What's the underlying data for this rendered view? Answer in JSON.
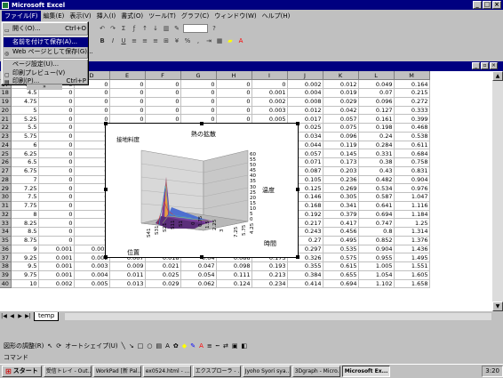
{
  "window": {
    "title": "Microsoft Excel",
    "min": "_",
    "max": "□",
    "close": "×"
  },
  "menu": [
    "ファイル(F)",
    "編集(E)",
    "表示(V)",
    "挿入(I)",
    "書式(O)",
    "ツール(T)",
    "グラフ(C)",
    "ウィンドウ(W)",
    "ヘルプ(H)"
  ],
  "toolbar": {
    "zoom": "",
    "question": "?"
  },
  "file_menu": {
    "open": {
      "label": "開く(O)...",
      "shortcut": "Ctrl+O"
    },
    "save_as": {
      "label": "名前を付けて保存(A)..."
    },
    "web_save": {
      "label": "Web ページとして保存(G)..."
    },
    "page_setup": {
      "label": "ページ設定(U)..."
    },
    "print_preview": {
      "label": "印刷プレビュー(V)"
    },
    "print": {
      "label": "印刷(P)...",
      "shortcut": "Ctrl+P"
    },
    "more": "»"
  },
  "columns": [
    "C",
    "D",
    "E",
    "F",
    "G",
    "H",
    "I",
    "J",
    "K",
    "L",
    "M"
  ],
  "rows": [
    {
      "n": "17",
      "b": "4.25",
      "c": [
        "0",
        "0",
        "0",
        "0",
        "0",
        "0",
        "0",
        "0.002",
        "0.012",
        "0.049",
        "0.164"
      ]
    },
    {
      "n": "18",
      "b": "4.5",
      "c": [
        "0",
        "0",
        "0",
        "0",
        "0",
        "0",
        "0.001",
        "0.004",
        "0.019",
        "0.07",
        "0.215"
      ]
    },
    {
      "n": "19",
      "b": "4.75",
      "c": [
        "0",
        "0",
        "0",
        "0",
        "0",
        "0",
        "0.002",
        "0.008",
        "0.029",
        "0.096",
        "0.272"
      ]
    },
    {
      "n": "20",
      "b": "5",
      "c": [
        "0",
        "0",
        "0",
        "0",
        "0",
        "0",
        "0.003",
        "0.012",
        "0.042",
        "0.127",
        "0.333"
      ]
    },
    {
      "n": "21",
      "b": "5.25",
      "c": [
        "0",
        "0",
        "0",
        "0",
        "0",
        "0",
        "0.005",
        "0.017",
        "0.057",
        "0.161",
        "0.399"
      ]
    },
    {
      "n": "22",
      "b": "5.5",
      "c": [
        "0",
        "0",
        "0",
        "0",
        "0",
        "0",
        "0.007",
        "0.025",
        "0.075",
        "0.198",
        "0.468"
      ]
    },
    {
      "n": "23",
      "b": "5.75",
      "c": [
        "0",
        "0",
        "0",
        "0",
        "0",
        "0",
        "0.01",
        "0.034",
        "0.096",
        "0.24",
        "0.538"
      ]
    },
    {
      "n": "24",
      "b": "6",
      "c": [
        "0",
        "0",
        "0",
        "0",
        "0",
        "0",
        "0.015",
        "0.044",
        "0.119",
        "0.284",
        "0.611"
      ]
    },
    {
      "n": "25",
      "b": "6.25",
      "c": [
        "0",
        "0",
        "0",
        "0",
        "0",
        "0",
        "0.02",
        "0.057",
        "0.145",
        "0.331",
        "0.684"
      ]
    },
    {
      "n": "26",
      "b": "6.5",
      "c": [
        "0",
        "0",
        "0",
        "0",
        "0",
        "0",
        "0.026",
        "0.071",
        "0.173",
        "0.38",
        "0.758"
      ]
    },
    {
      "n": "27",
      "b": "6.75",
      "c": [
        "0",
        "0",
        "0",
        "0",
        "0",
        "0",
        "0.034",
        "0.087",
        "0.203",
        "0.43",
        "0.831"
      ]
    },
    {
      "n": "28",
      "b": "7",
      "c": [
        "0",
        "0",
        "0",
        "0",
        "0",
        "0",
        "0.043",
        "0.105",
        "0.236",
        "0.482",
        "0.904"
      ]
    },
    {
      "n": "29",
      "b": "7.25",
      "c": [
        "0",
        "0",
        "0",
        "0",
        "0",
        "0",
        "0.053",
        "0.125",
        "0.269",
        "0.534",
        "0.976"
      ]
    },
    {
      "n": "30",
      "b": "7.5",
      "c": [
        "0",
        "0",
        "0",
        "0",
        "0",
        "0",
        "0.064",
        "0.146",
        "0.305",
        "0.587",
        "1.047"
      ]
    },
    {
      "n": "31",
      "b": "7.75",
      "c": [
        "0",
        "0",
        "0",
        "0",
        "0",
        "0",
        "0.076",
        "0.168",
        "0.341",
        "0.641",
        "1.116"
      ]
    },
    {
      "n": "32",
      "b": "8",
      "c": [
        "0",
        "0",
        "0",
        "0",
        "0",
        "0",
        "0.09",
        "0.192",
        "0.379",
        "0.694",
        "1.184"
      ]
    },
    {
      "n": "33",
      "b": "8.25",
      "c": [
        "0",
        "0",
        "0",
        "0",
        "0",
        "0",
        "0.105",
        "0.217",
        "0.417",
        "0.747",
        "1.25"
      ]
    },
    {
      "n": "34",
      "b": "8.5",
      "c": [
        "0",
        "0",
        "0",
        "0",
        "0",
        "0",
        "0.12",
        "0.243",
        "0.456",
        "0.8",
        "1.314"
      ]
    },
    {
      "n": "35",
      "b": "8.75",
      "c": [
        "0",
        "0",
        "0",
        "0",
        "0",
        "0",
        "0.137",
        "0.27",
        "0.495",
        "0.852",
        "1.376"
      ]
    },
    {
      "n": "36",
      "b": "9",
      "c": [
        "0",
        "0.001",
        "0.002",
        "0.006",
        "0.014",
        "0.034",
        "0.075",
        "0.155",
        "0.297",
        "0.535",
        "0.904",
        "1.436"
      ]
    },
    {
      "n": "37",
      "b": "9.25",
      "c": [
        "0",
        "0.001",
        "0.002",
        "0.007",
        "0.018",
        "0.04",
        "0.086",
        "0.173",
        "0.326",
        "0.575",
        "0.955",
        "1.495"
      ]
    },
    {
      "n": "38",
      "b": "9.5",
      "c": [
        "0",
        "0.001",
        "0.003",
        "0.009",
        "0.021",
        "0.047",
        "0.098",
        "0.193",
        "0.355",
        "0.615",
        "1.005",
        "1.551"
      ]
    },
    {
      "n": "39",
      "b": "9.75",
      "c": [
        "0",
        "0.001",
        "0.004",
        "0.011",
        "0.025",
        "0.054",
        "0.111",
        "0.213",
        "0.384",
        "0.655",
        "1.054",
        "1.605"
      ]
    },
    {
      "n": "40",
      "b": "10",
      "c": [
        "0",
        "0.002",
        "0.005",
        "0.013",
        "0.029",
        "0.062",
        "0.124",
        "0.234",
        "0.414",
        "0.694",
        "1.102",
        "1.658"
      ]
    }
  ],
  "chart": {
    "title": "熱の拡散",
    "subtitle": "接地料度",
    "zlabel": "温度",
    "xlabel": "時間",
    "ylabel": "位置",
    "zticks": [
      "60",
      "55",
      "50",
      "45",
      "40",
      "35",
      "30",
      "25",
      "20",
      "15",
      "10",
      "5",
      "0"
    ],
    "yticks": [
      "S41",
      "S31",
      "S21",
      "S11",
      "S1"
    ],
    "xticks": [
      "0",
      "0.75",
      "1.5",
      "2.25",
      "3"
    ],
    "xticks2": [
      "7.25",
      "5.75",
      "4.25"
    ]
  },
  "sheet_tab": "temp",
  "drawbar": {
    "draw": "図形の調整(R)",
    "autoshape": "オートシェイプ(U)"
  },
  "status": "コマンド",
  "taskbar": {
    "start": "スタート",
    "items": [
      "受信トレイ - Out...",
      "WorkPad [新 Pal...",
      "ex0524.html - ...",
      "エクスプローラ - ...",
      "Jyoho Syori sya...",
      "3Dgraph - Micro...",
      "Microsoft Ex..."
    ],
    "clock": "3:20"
  }
}
